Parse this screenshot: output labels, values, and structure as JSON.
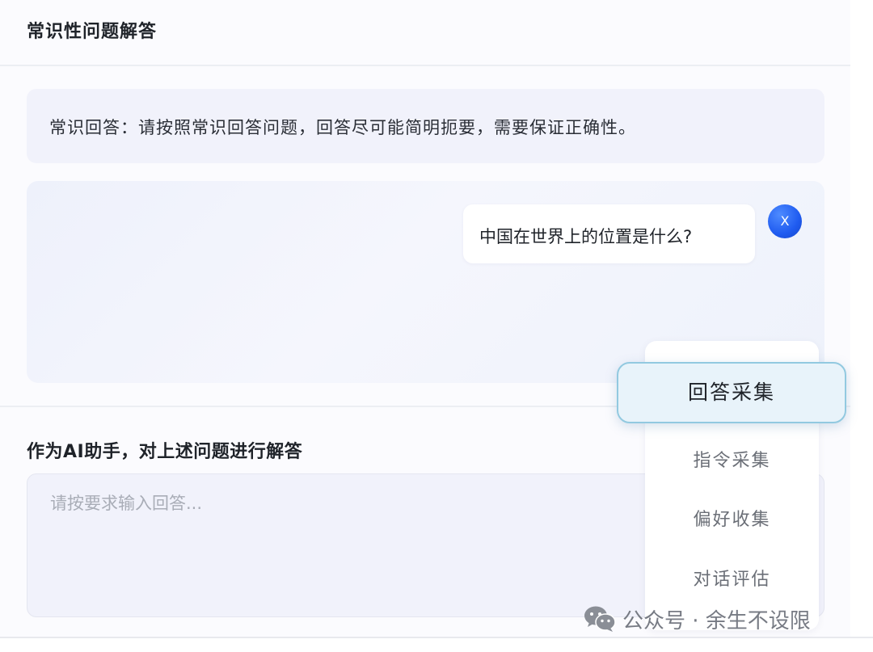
{
  "header": {
    "title": "常识性问题解答"
  },
  "instruction": {
    "text": "常识回答：请按照常识回答问题，回答尽可能简明扼要，需要保证正确性。"
  },
  "chat": {
    "question": "中国在世界上的位置是什么?",
    "avatar_label": "X"
  },
  "answer": {
    "label": "作为AI助手，对上述问题进行解答",
    "placeholder": "请按要求输入回答..."
  },
  "dropdown": {
    "selected": "回答采集",
    "options": [
      "指令采集",
      "偏好收集",
      "对话评估"
    ]
  },
  "watermark": {
    "text": "公众号 · 余生不设限"
  },
  "colors": {
    "accent": "#1f5bf0",
    "selected_border": "#92c9e0",
    "selected_bg": "#e8f3fa"
  }
}
